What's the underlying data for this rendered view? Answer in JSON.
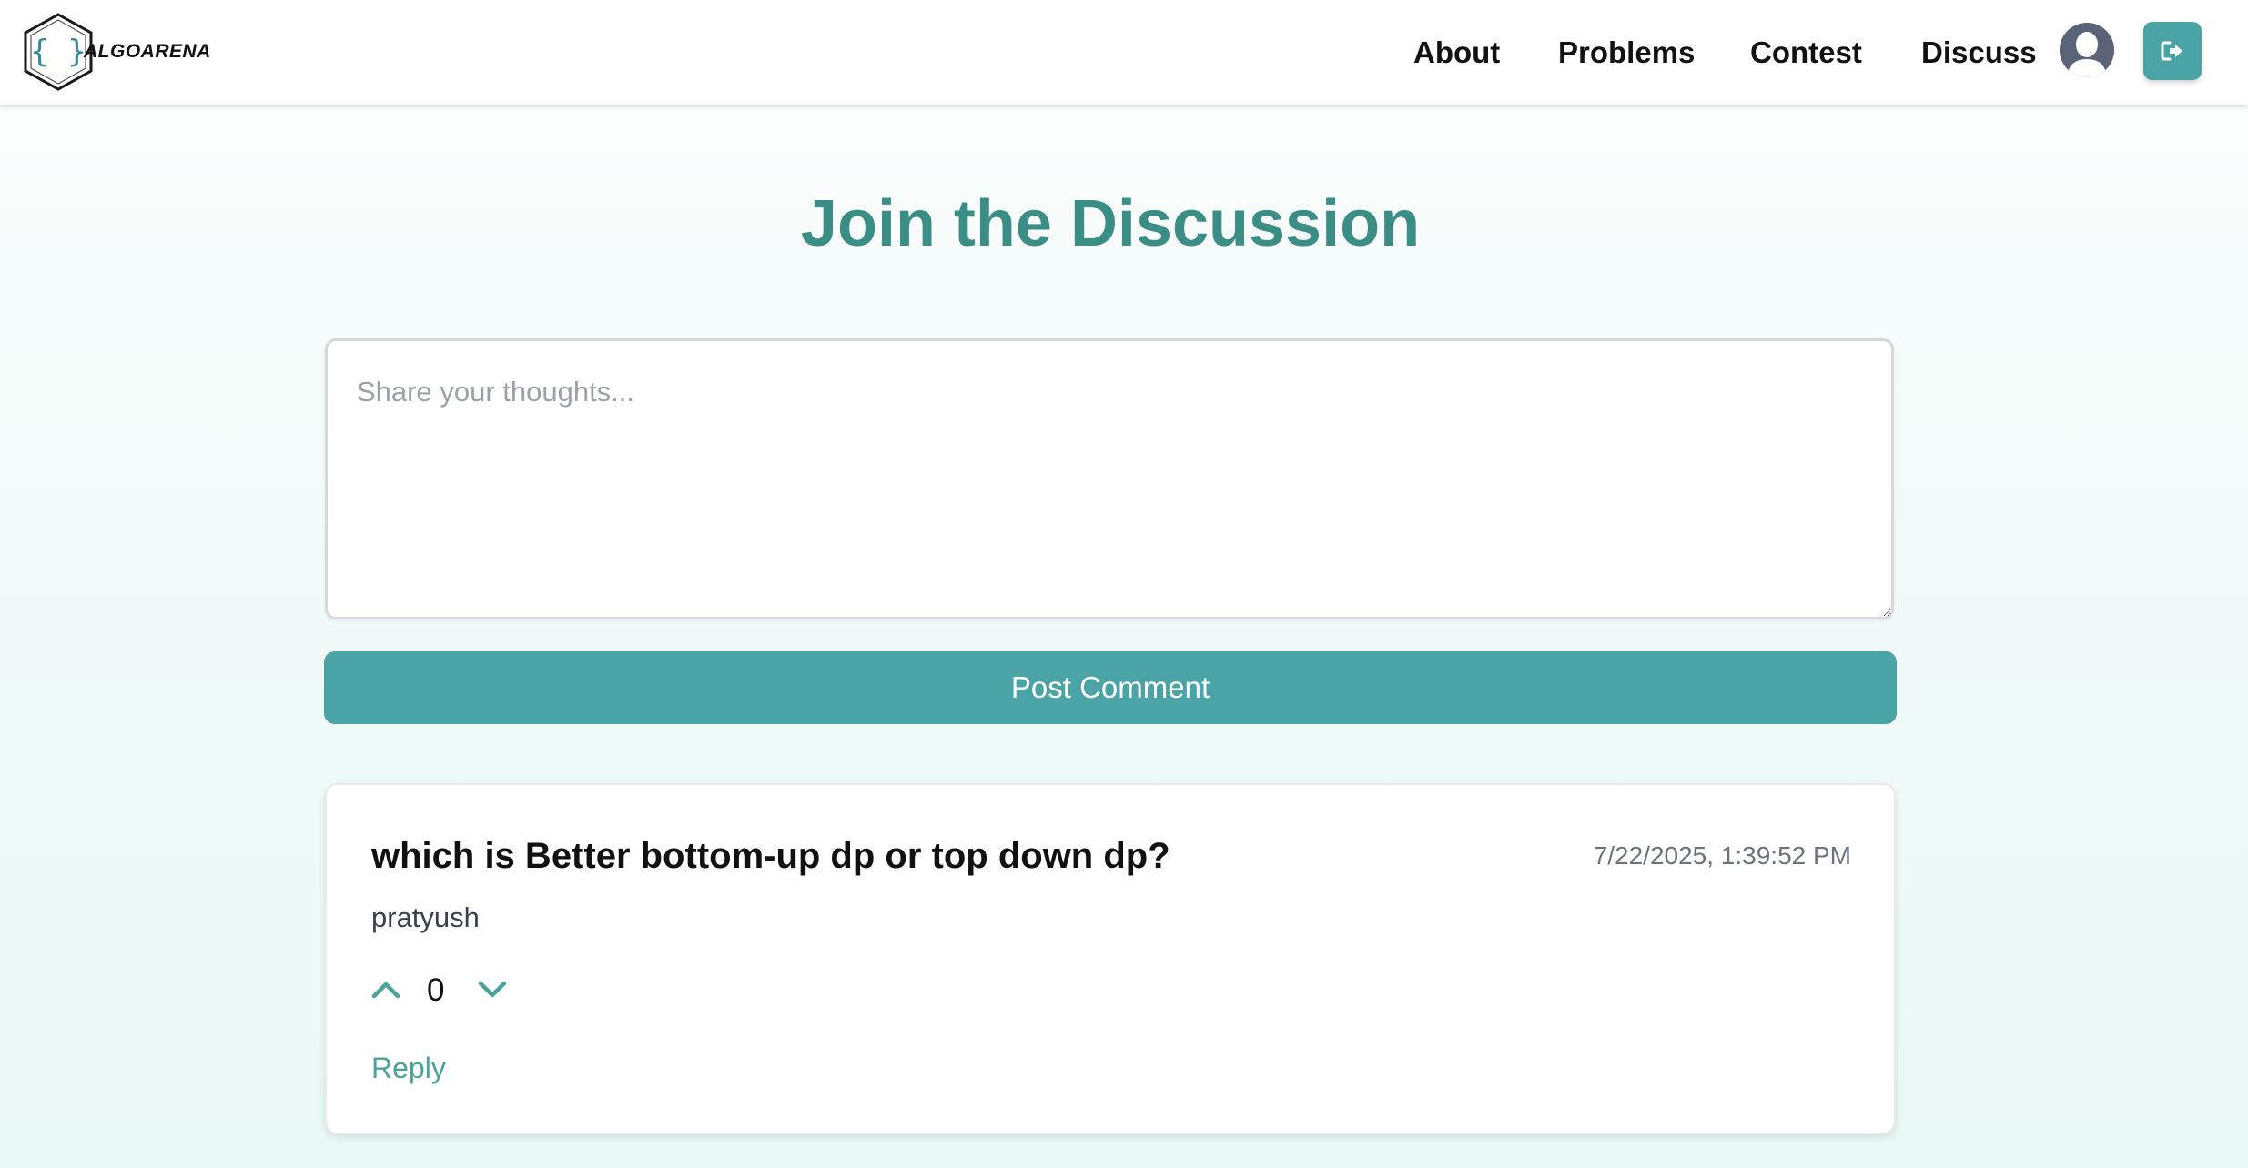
{
  "header": {
    "brand": "ALGOARENA",
    "nav": [
      {
        "label": "About"
      },
      {
        "label": "Problems"
      },
      {
        "label": "Contest"
      },
      {
        "label": "Discuss"
      }
    ],
    "avatar_icon": "user-avatar-icon",
    "logout_icon": "logout-icon"
  },
  "main": {
    "title": "Join the Discussion",
    "comment_placeholder": "Share your thoughts...",
    "comment_value": "",
    "post_button_label": "Post Comment"
  },
  "comments": [
    {
      "title": "which is Better bottom-up dp or top down dp?",
      "timestamp": "7/22/2025, 1:39:52 PM",
      "author": "pratyush",
      "votes": "0",
      "reply_label": "Reply"
    }
  ],
  "colors": {
    "accent": "#4aa3a5",
    "title": "#3a8e85",
    "reply": "#4aa39a"
  }
}
